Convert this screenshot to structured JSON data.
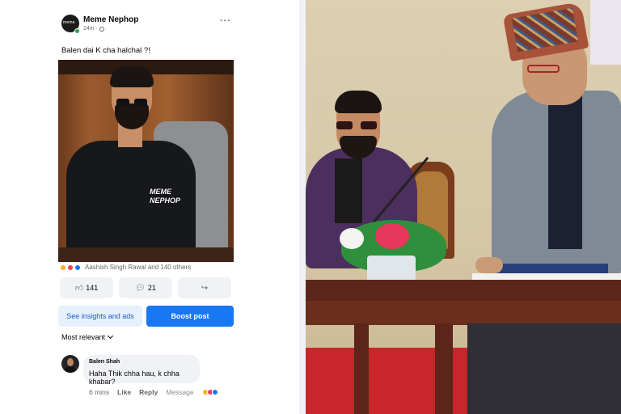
{
  "post": {
    "author": "Meme Nephop",
    "avatar_text": "meme",
    "time": "24m",
    "meta_separator": "·",
    "caption": "Balen dai K cha halchal ?!",
    "image_watermark": "MEME\nNEPHOP",
    "reactions_summary": "Aashish Singh Rawal and 140 others",
    "likes_count": "141",
    "comments_count": "21",
    "insights_label": "See insights and ads",
    "boost_label": "Boost post",
    "sort_label": "Most relevant",
    "icons": {
      "more": "more-icon",
      "like": "thumbs-up-icon",
      "comment": "comment-icon",
      "share": "share-icon",
      "globe": "globe-icon"
    }
  },
  "comment": {
    "author": "Balen Shah",
    "text": "Haha Thik chha hau, k chha khabar?",
    "time": "6 mins",
    "like_label": "Like",
    "reply_label": "Reply",
    "message_label": "Message"
  },
  "colors": {
    "accent": "#1877f2",
    "online": "#31a24c",
    "carpet": "#c8262a"
  }
}
